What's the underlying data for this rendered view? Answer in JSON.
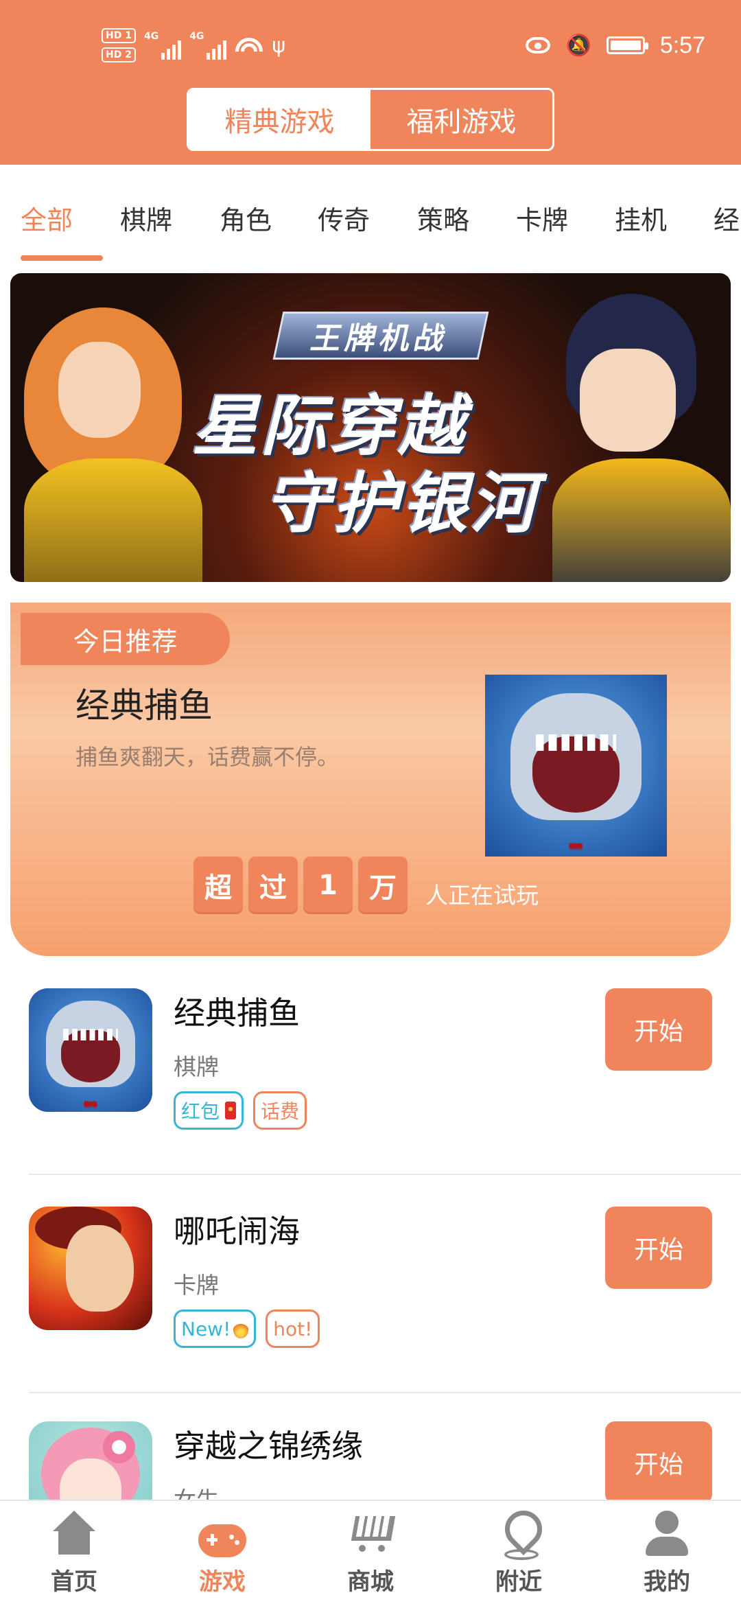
{
  "status_bar": {
    "hd1": "HD 1",
    "hd2": "HD 2",
    "net1": "4G",
    "net2": "4G",
    "time": "5:57"
  },
  "segment": {
    "classic": "精典游戏",
    "welfare": "福利游戏"
  },
  "categories": [
    "全部",
    "棋牌",
    "角色",
    "传奇",
    "策略",
    "卡牌",
    "挂机",
    "经"
  ],
  "banner": {
    "logo_text": "王牌机战",
    "line1": "星际穿越",
    "line2": "守护银河"
  },
  "recommend": {
    "tag": "今日推荐",
    "title": "经典捕鱼",
    "desc": "捕鱼爽翻天，话费赢不停。",
    "badge": "抢红包",
    "counter": [
      "超",
      "过",
      "1",
      "万"
    ],
    "counter_label": "人正在试玩"
  },
  "games": [
    {
      "name": "经典捕鱼",
      "category": "棋牌",
      "tags": [
        "红包",
        "话费"
      ],
      "badge": "抢红包",
      "action": "开始"
    },
    {
      "name": "哪吒闹海",
      "category": "卡牌",
      "tags": [
        "New!",
        "hot!"
      ],
      "action": "开始"
    },
    {
      "name": "穿越之锦绣缘",
      "category": "女生",
      "action": "开始"
    }
  ],
  "tabbar": [
    "首页",
    "游戏",
    "商城",
    "附近",
    "我的"
  ],
  "colors": {
    "accent": "#F0845A",
    "tag_blue": "#35B6D6"
  }
}
